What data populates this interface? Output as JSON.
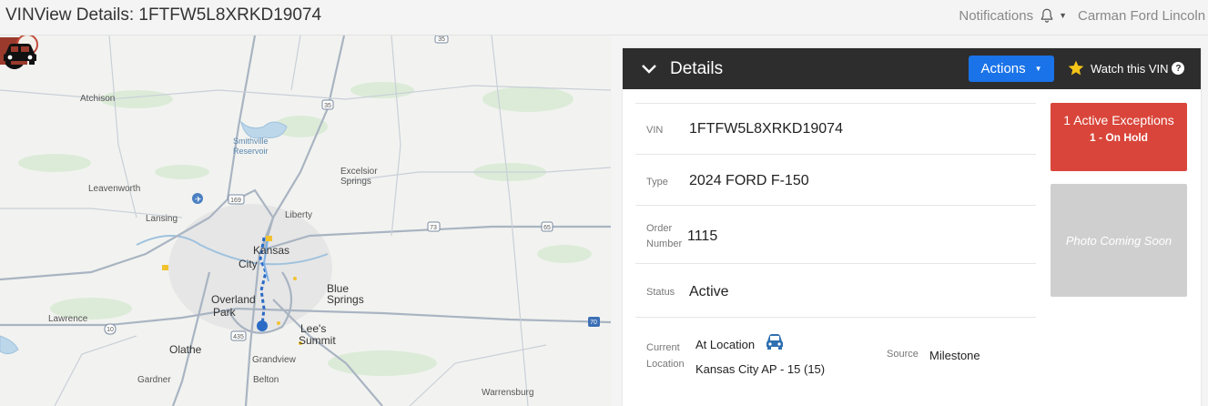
{
  "header": {
    "title": "VINView Details: 1FTFW5L8XRKD19074",
    "notifications_label": "Notifications",
    "dealer_name": "Carman Ford Lincoln"
  },
  "map": {
    "labels": {
      "atchison": "Atchison",
      "smithville": "Smithville",
      "reservoir": "Reservoir",
      "excelsior": "Excelsior",
      "springs": "Springs",
      "leavenworth": "Leavenworth",
      "lansing": "Lansing",
      "liberty": "Liberty",
      "kansas_city_a": "Kansas",
      "kansas_city_b": "City",
      "overland": "Overland",
      "park": "Park",
      "blue": "Blue",
      "blue_springs": "Springs",
      "lawrence": "Lawrence",
      "lees": "Lee's",
      "summit": "Summit",
      "olathe": "Olathe",
      "grandview": "Grandview",
      "gardner": "Gardner",
      "belton": "Belton",
      "warrensburg": "Warrensburg"
    },
    "shields": {
      "i35": "35",
      "i169": "169",
      "i35b": "35",
      "i65": "65",
      "i73": "73",
      "i10": "10",
      "i435": "435",
      "i70": "70"
    }
  },
  "details": {
    "title": "Details",
    "actions_label": "Actions",
    "watch_label": "Watch this VIN",
    "vin_label": "VIN",
    "vin": "1FTFW5L8XRKD19074",
    "type_label": "Type",
    "type": "2024 FORD F-150",
    "order_label_1": "Order",
    "order_label_2": "Number",
    "order_number": "1115",
    "status_label": "Status",
    "status": "Active",
    "location_label_1": "Current",
    "location_label_2": "Location",
    "location_state": "At Location",
    "location_place": "Kansas City AP - 15 (15)",
    "source_label": "Source",
    "source": "Milestone"
  },
  "exceptions": {
    "line1": "1 Active Exceptions",
    "line2": "1 - On Hold"
  },
  "photo": {
    "text": "Photo Coming Soon"
  },
  "colors": {
    "accent_blue": "#1a73e8",
    "exception_red": "#d9453a",
    "header_dark": "#2d2d2d",
    "star": "#f5c518"
  }
}
